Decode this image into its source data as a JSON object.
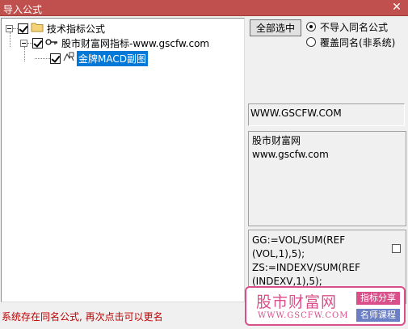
{
  "window": {
    "title": "导入公式",
    "close_glyph": "✕"
  },
  "tree": {
    "root": {
      "label": "技术指标公式",
      "checked": true
    },
    "group": {
      "label": "股市财富网指标-www.gscfw.com",
      "checked": true
    },
    "leaf": {
      "label": "金牌MACD副图",
      "checked": true,
      "selected": true
    }
  },
  "options": {
    "select_all_label": "全部选中",
    "radio_no_import": "不导入同名公式",
    "radio_overwrite": "覆盖同名(非系统)",
    "selected_radio": "no_import"
  },
  "info": {
    "url": "WWW.GSCFW.COM",
    "desc_line1": "股市财富网",
    "desc_line2": "www.gscfw.com"
  },
  "code": {
    "lines": [
      "GG:=VOL/SUM(REF",
      "(VOL,1),5);",
      "ZS:=INDEXV/SUM(REF",
      "(INDEXV,1),5);"
    ]
  },
  "status": {
    "message": "系统存在同名公式, 再次点击可以更名"
  },
  "watermark": {
    "brand": "股市财富网",
    "url": "WWW.GSCFW.COM",
    "tag1": "指标分享",
    "tag2": "名师课程"
  },
  "colors": {
    "titlebar": "#c0504d",
    "selection": "#0078d7",
    "status_text": "#c00000",
    "watermark_pink": "#d94f8a",
    "watermark_blue": "#6b7fc4"
  }
}
